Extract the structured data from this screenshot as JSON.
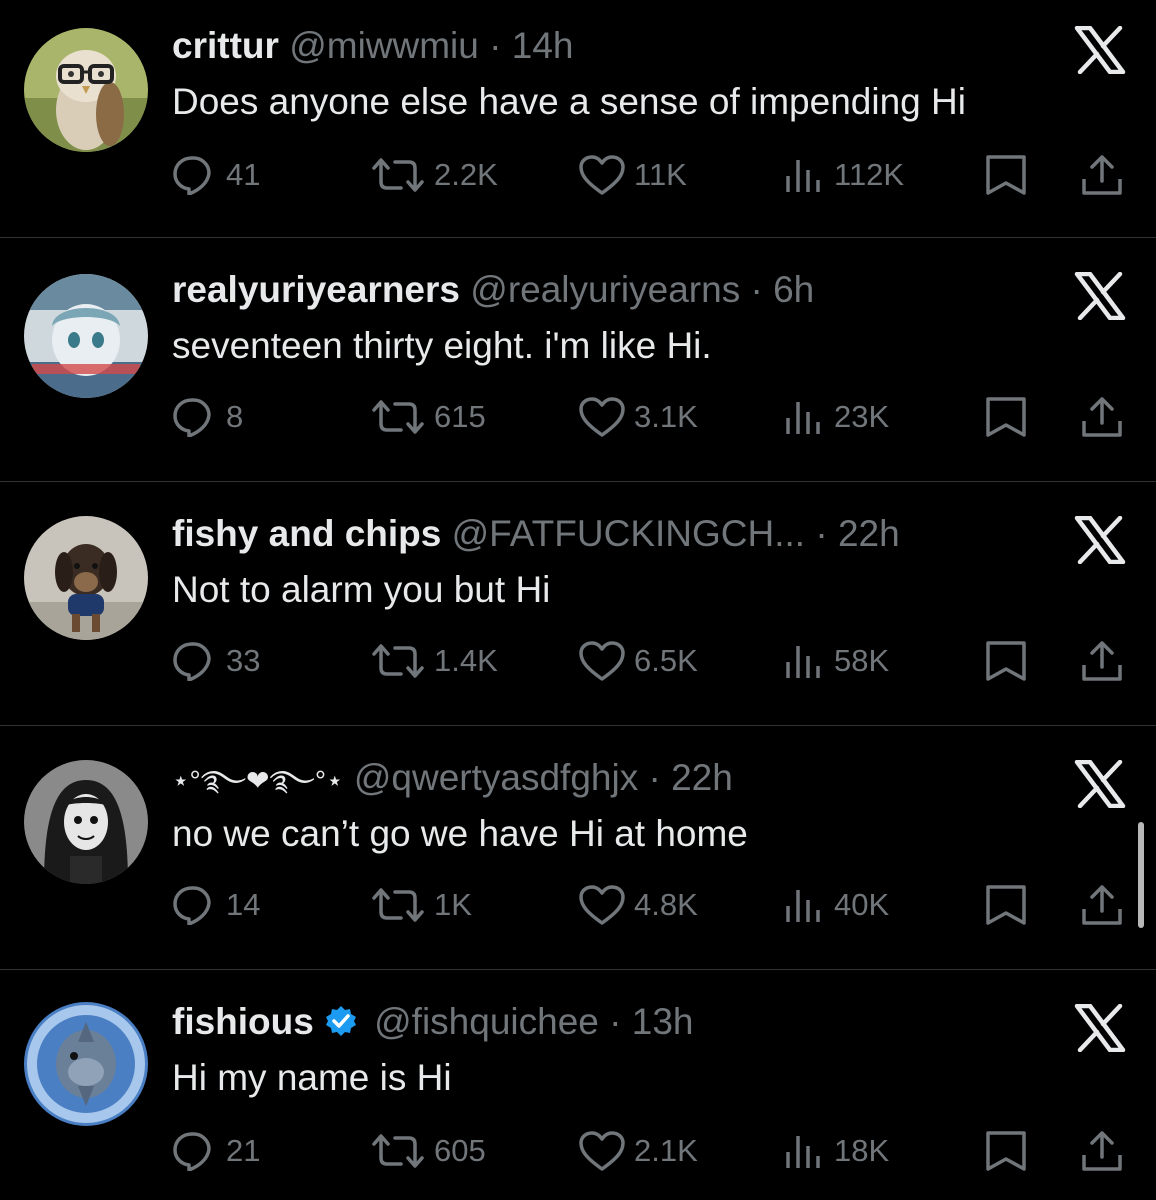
{
  "colors": {
    "background": "#000000",
    "primary_text": "#e7e9ea",
    "secondary_text": "#71767b",
    "divider": "#2f3336",
    "verified_blue": "#1d9bf0"
  },
  "tweets": [
    {
      "display_name": "crittur",
      "handle": "@miwwmiu",
      "separator": "·",
      "time": "14h",
      "text": "Does anyone else have a sense of impending Hi",
      "verified": false,
      "replies": "41",
      "retweets": "2.2K",
      "likes": "11K",
      "views": "112K"
    },
    {
      "display_name": "realyuriyearners",
      "handle": "@realyuriyearns",
      "separator": "·",
      "time": "6h",
      "text": "seventeen thirty eight. i'm like Hi.",
      "verified": false,
      "replies": "8",
      "retweets": "615",
      "likes": "3.1K",
      "views": "23K"
    },
    {
      "display_name": "fishy and chips",
      "handle": "@FATFUCKINGCH...",
      "separator": "·",
      "time": "22h",
      "text": "Not to alarm you but  Hi",
      "verified": false,
      "replies": "33",
      "retweets": "1.4K",
      "likes": "6.5K",
      "views": "58K"
    },
    {
      "display_name": "⋆°࿐❤︎࿐°⋆",
      "handle": "@qwertyasdfghjx",
      "separator": "·",
      "time": "22h",
      "text": "no we can’t go we have Hi at home",
      "verified": false,
      "replies": "14",
      "retweets": "1K",
      "likes": "4.8K",
      "views": "40K"
    },
    {
      "display_name": "fishious",
      "handle": "@fishquichee",
      "separator": "·",
      "time": "13h",
      "text": "Hi my name is Hi",
      "verified": true,
      "replies": "21",
      "retweets": "605",
      "likes": "2.1K",
      "views": "18K"
    }
  ],
  "icons": {
    "reply": "reply-icon",
    "retweet": "retweet-icon",
    "like": "heart-icon",
    "views": "views-icon",
    "bookmark": "bookmark-icon",
    "share": "share-icon",
    "close": "x-logo-icon",
    "verified": "verified-badge-icon"
  }
}
